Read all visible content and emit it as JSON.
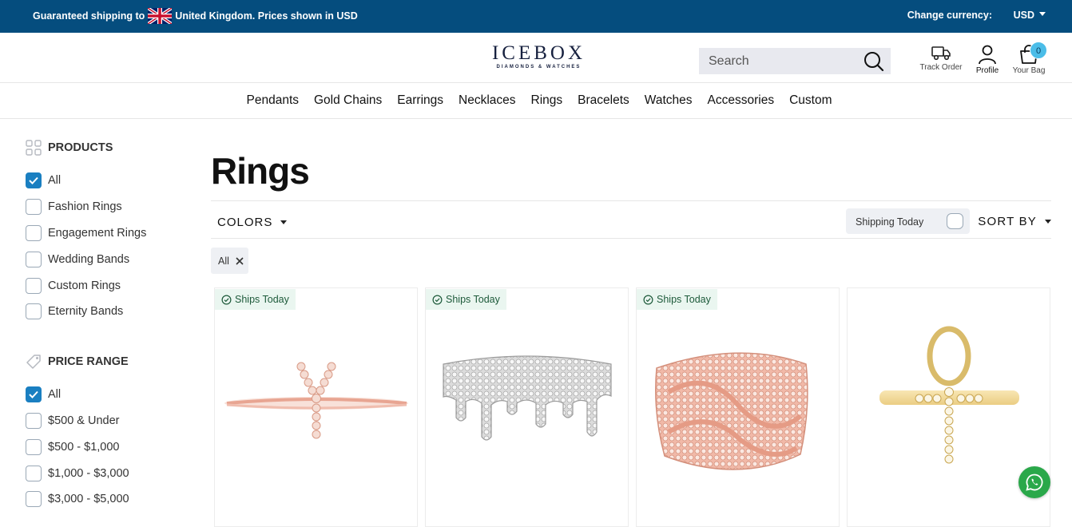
{
  "topbar": {
    "shipping_prefix": "Guaranteed shipping to",
    "shipping_suffix": "United Kingdom. Prices shown in USD",
    "change_currency_label": "Change currency:",
    "currency": "USD",
    "bg_color": "#054d7e"
  },
  "header": {
    "logo_word": "ICEBOX",
    "logo_sub": "DIAMONDS & WATCHES",
    "search_placeholder": "Search",
    "track_order": "Track Order",
    "profile": "Profile",
    "bag": "Your Bag",
    "bag_count": "0"
  },
  "nav": {
    "items": [
      "Pendants",
      "Gold Chains",
      "Earrings",
      "Necklaces",
      "Rings",
      "Bracelets",
      "Watches",
      "Accessories",
      "Custom"
    ]
  },
  "sidebar": {
    "products_title": "PRODUCTS",
    "products": [
      {
        "label": "All",
        "checked": true
      },
      {
        "label": "Fashion Rings",
        "checked": false
      },
      {
        "label": "Engagement Rings",
        "checked": false
      },
      {
        "label": "Wedding Bands",
        "checked": false
      },
      {
        "label": "Custom Rings",
        "checked": false
      },
      {
        "label": "Eternity Bands",
        "checked": false
      }
    ],
    "price_title": "PRICE RANGE",
    "prices": [
      {
        "label": "All",
        "checked": true
      },
      {
        "label": "$500 & Under",
        "checked": false
      },
      {
        "label": "$500 - $1,000",
        "checked": false
      },
      {
        "label": "$1,000 - $3,000",
        "checked": false
      },
      {
        "label": "$3,000 - $5,000",
        "checked": false
      }
    ]
  },
  "main": {
    "title": "Rings",
    "colors_label": "COLORS",
    "shipping_today_label": "Shipping Today",
    "shipping_today_on": false,
    "sort_label": "SORT BY",
    "active_filter": "All",
    "badge_text": "Ships Today",
    "products": [
      {
        "image": "letter-y-ring-rose-gold",
        "ships_today": true
      },
      {
        "image": "drip-ring-white-gold",
        "ships_today": true
      },
      {
        "image": "cuban-link-ring-rose-gold",
        "ships_today": true
      },
      {
        "image": "ankh-ring-yellow-gold",
        "ships_today": false
      }
    ]
  },
  "colors": {
    "accent": "#1a7fc1",
    "badge_bg": "#eaf6f0",
    "whatsapp": "#2aa84a"
  }
}
